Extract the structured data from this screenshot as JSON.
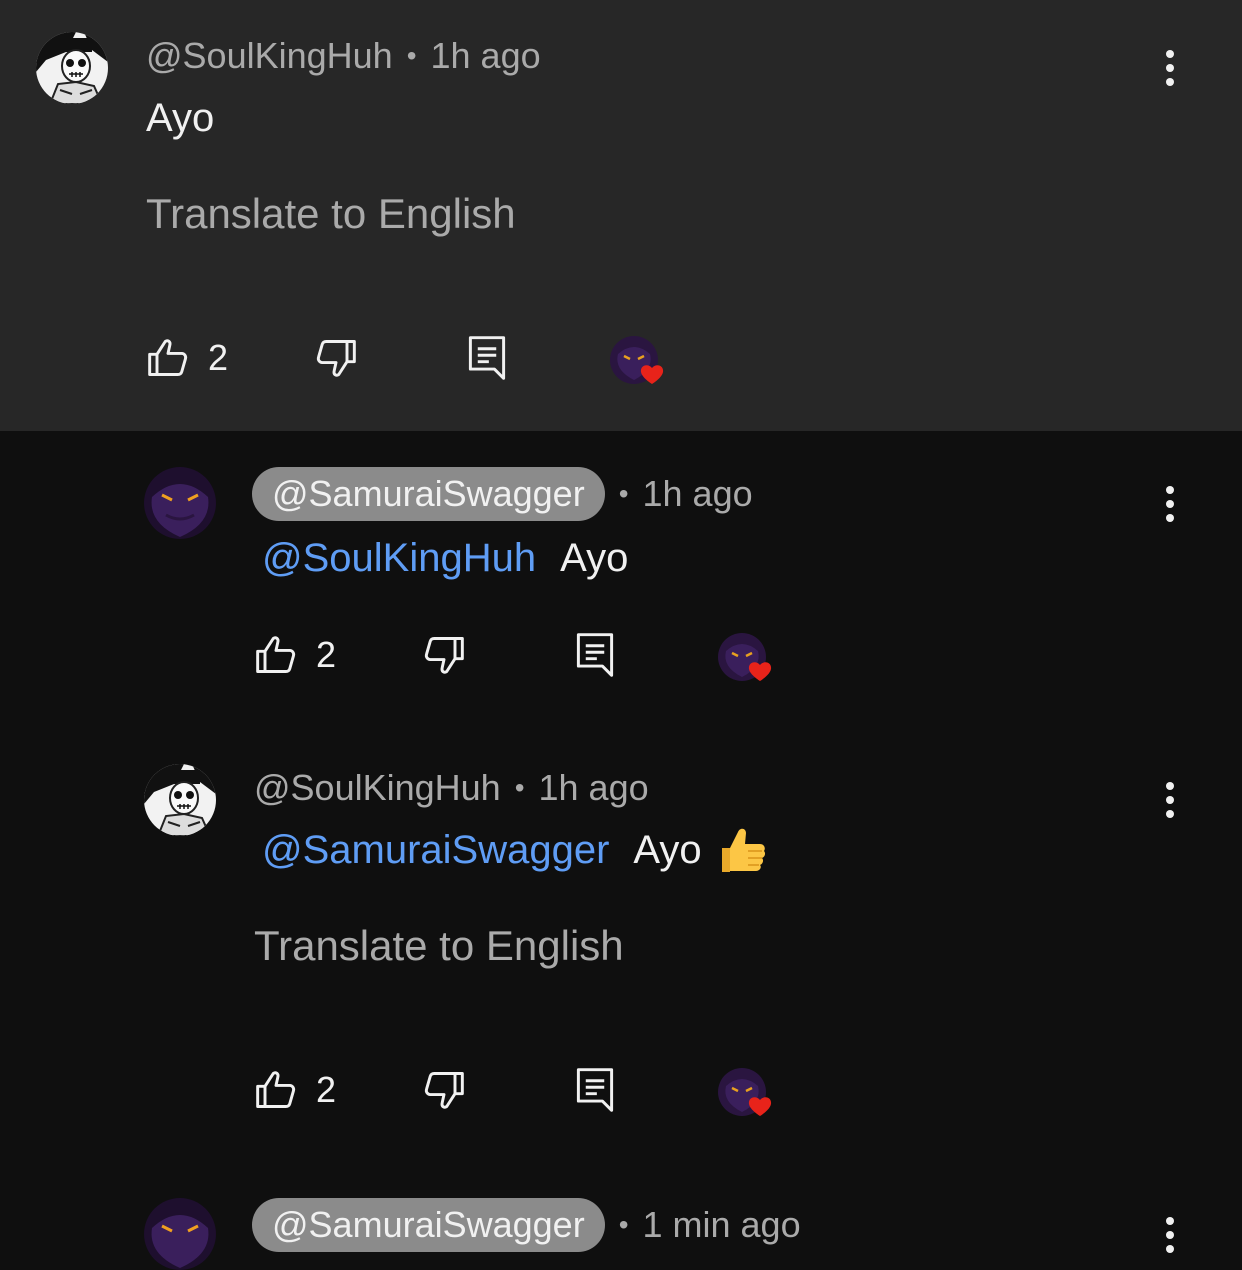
{
  "comments": [
    {
      "author": "@SoulKingHuh",
      "time": "1h ago",
      "text": "Ayo",
      "mention": "",
      "translate": "Translate to English",
      "likes": "2",
      "avatar": "skeleton-avatar"
    },
    {
      "author": "@SamuraiSwagger",
      "time": "1h ago",
      "mention": "@SoulKingHuh",
      "text": "Ayo",
      "likes": "2",
      "avatar": "purple-creature-avatar"
    },
    {
      "author": "@SoulKingHuh",
      "time": "1h ago",
      "mention": "@SamuraiSwagger",
      "text": "Ayo",
      "translate": "Translate to English",
      "likes": "2",
      "avatar": "skeleton-avatar"
    },
    {
      "author": "@SamuraiSwagger",
      "time": "1 min ago",
      "avatar": "purple-creature-avatar"
    }
  ],
  "separator": "•",
  "colors": {
    "highlight_bg": "#272727",
    "page_bg": "#0f0f0f",
    "mention": "#5f9df5",
    "heart": "#e8231a",
    "creator_pill": "#8b8b8b"
  }
}
